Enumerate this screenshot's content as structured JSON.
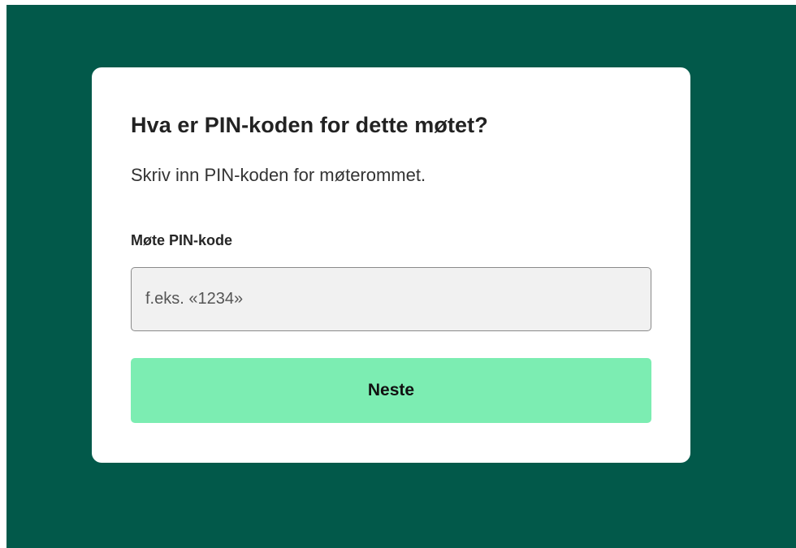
{
  "dialog": {
    "title": "Hva er PIN-koden for dette møtet?",
    "subtitle": "Skriv inn PIN-koden for møterommet.",
    "pin_field": {
      "label": "Møte PIN-kode",
      "value": "",
      "placeholder": "f.eks. «1234»"
    },
    "next_label": "Neste"
  },
  "colors": {
    "background": "#02594a",
    "card": "#ffffff",
    "button": "#7cedb2",
    "input_background": "#f1f1f1"
  }
}
